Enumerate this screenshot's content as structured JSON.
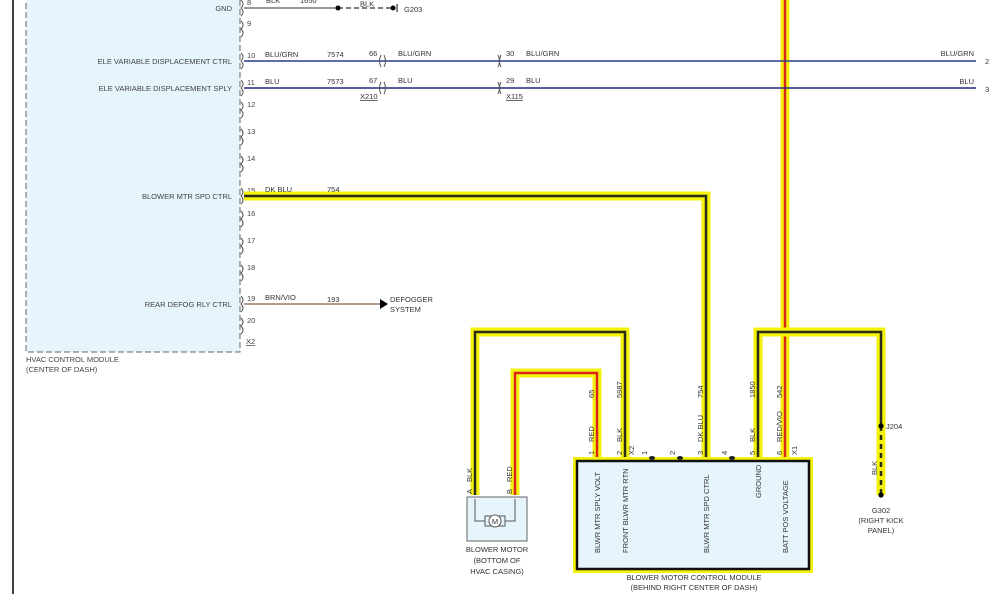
{
  "hvac_module": {
    "label": [
      "HVAC CONTROL MODULE",
      "(CENTER OF DASH)"
    ],
    "connector": "X2",
    "pins": [
      {
        "num": "8",
        "name": "GND"
      },
      {
        "num": "9",
        "name": ""
      },
      {
        "num": "10",
        "name": "ELE VARIABLE DISPLACEMENT CTRL"
      },
      {
        "num": "11",
        "name": "ELE VARIABLE DISPLACEMENT SPLY"
      },
      {
        "num": "12",
        "name": ""
      },
      {
        "num": "13",
        "name": ""
      },
      {
        "num": "14",
        "name": ""
      },
      {
        "num": "15",
        "name": "BLOWER MTR SPD CTRL"
      },
      {
        "num": "16",
        "name": ""
      },
      {
        "num": "17",
        "name": ""
      },
      {
        "num": "18",
        "name": ""
      },
      {
        "num": "19",
        "name": "REAR DEFOG RLY CTRL"
      },
      {
        "num": "20",
        "name": ""
      }
    ]
  },
  "wires": {
    "gnd": {
      "color": "BLK",
      "circuit": "1650",
      "color2": "BLK",
      "ground": "G203"
    },
    "ctrl": {
      "color": "BLU/GRN",
      "circuit": "7574",
      "x210_pin": "66",
      "color2": "BLU/GRN",
      "x115_pin": "30",
      "color3": "BLU/GRN",
      "end_color": "BLU/GRN",
      "end_pin": "2"
    },
    "sply": {
      "color": "BLU",
      "circuit": "7573",
      "x210_pin": "67",
      "color2": "BLU",
      "x115_pin": "29",
      "color3": "BLU",
      "end_color": "BLU",
      "end_pin": "3"
    },
    "connectors": {
      "x210": "X210",
      "x115": "X115"
    },
    "spd": {
      "color": "DK BLU",
      "circuit": "754"
    },
    "defog": {
      "color": "BRN/VIO",
      "circuit": "193",
      "dest": [
        "DEFOGGER",
        "SYSTEM"
      ]
    }
  },
  "blower_motor": {
    "label": [
      "BLOWER MOTOR",
      "(BOTTOM OF",
      "HVAC CASING)"
    ],
    "symbol": "M",
    "pin_a": "A",
    "pin_a_color": "BLK",
    "pin_b": "B",
    "pin_b_color": "RED"
  },
  "bmcm": {
    "label": [
      "BLOWER MOTOR CONTROL MODULE",
      "(BEHIND RIGHT CENTER OF DASH)"
    ],
    "x2": "X2",
    "x1": "X1",
    "x2_pins": [
      {
        "num": "1",
        "color": "RED",
        "circuit": "65",
        "name": "BLWR MTR SPLY VOLT"
      },
      {
        "num": "2",
        "color": "BLK",
        "circuit": "5987",
        "name": "FRONT BLWR MTR RTN"
      }
    ],
    "x1_pins": [
      {
        "num": "1"
      },
      {
        "num": "2"
      },
      {
        "num": "3",
        "color": "DK BLU",
        "circuit": "754",
        "name": "BLWR MTR SPD CTRL"
      },
      {
        "num": "4"
      },
      {
        "num": "5",
        "color": "BLK",
        "circuit": "1850",
        "name": "GROUND"
      },
      {
        "num": "6",
        "color": "RED/VIO",
        "circuit": "542",
        "name": "BATT POS VOLTAGE"
      }
    ]
  },
  "ground_g302": {
    "splice": "J204",
    "color": "BLK",
    "name": "G302",
    "location": [
      "(RIGHT KICK",
      "PANEL)"
    ]
  },
  "colors": {
    "highlight": "#f5f20a",
    "blu_wire": "#2a3b8f",
    "brn_vio_wire": "#a07868",
    "red_wire": "#d8261b",
    "module_fill": "#e6f4fc"
  }
}
